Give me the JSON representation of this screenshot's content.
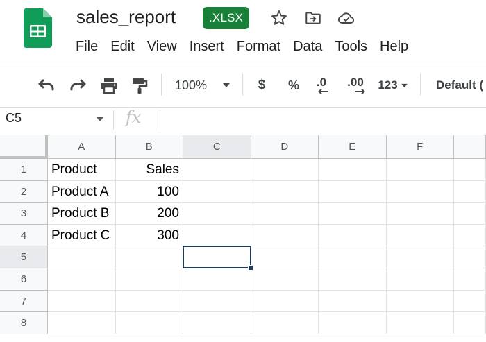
{
  "document": {
    "title": "sales_report",
    "format_badge": ".XLSX"
  },
  "title_icons": [
    "star-icon",
    "move-to-folder-icon",
    "cloud-saved-icon"
  ],
  "menu": [
    "File",
    "Edit",
    "View",
    "Insert",
    "Format",
    "Data",
    "Tools",
    "Help"
  ],
  "toolbar": {
    "zoom": "100%",
    "currency": "$",
    "percent": "%",
    "decrease_decimal": ".0",
    "increase_decimal": ".00",
    "number_format": "123",
    "font": "Default ("
  },
  "formula_bar": {
    "name_box": "C5",
    "fx": "fx",
    "value": ""
  },
  "sheet": {
    "columns": [
      "A",
      "B",
      "C",
      "D",
      "E",
      "F"
    ],
    "rows": [
      "1",
      "2",
      "3",
      "4",
      "5",
      "6",
      "7",
      "8"
    ],
    "cells": [
      [
        "Product",
        "Sales",
        "",
        "",
        "",
        ""
      ],
      [
        "Product A",
        "100",
        "",
        "",
        "",
        ""
      ],
      [
        "Product B",
        "200",
        "",
        "",
        "",
        ""
      ],
      [
        "Product C",
        "300",
        "",
        "",
        "",
        ""
      ],
      [
        "",
        "",
        "",
        "",
        "",
        ""
      ],
      [
        "",
        "",
        "",
        "",
        "",
        ""
      ],
      [
        "",
        "",
        "",
        "",
        "",
        ""
      ],
      [
        "",
        "",
        "",
        "",
        "",
        ""
      ]
    ],
    "numeric_columns": [
      1
    ],
    "active_cell": {
      "col": 2,
      "row": 4
    }
  },
  "colors": {
    "brand_green": "#188038",
    "selection": "#1f3b57"
  }
}
